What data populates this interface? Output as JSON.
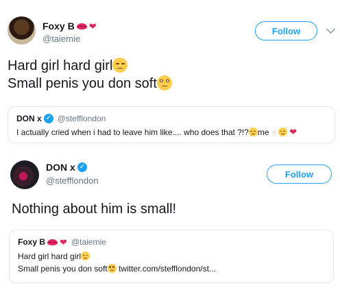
{
  "tweet1": {
    "name": "Foxy B",
    "handle": "@taiemie",
    "follow_label": "Follow",
    "line1": "Hard girl hard girl",
    "line2": "Small penis you don soft",
    "quote": {
      "name": "DON x",
      "handle": "@stefflondon",
      "text": "I actually cried when i had to leave him like.... who does that ?!?",
      "suffix": "me"
    }
  },
  "tweet2": {
    "name": "DON x",
    "handle": "@stefflondon",
    "follow_label": "Follow",
    "text": "Nothing about him is small!",
    "quote": {
      "name": "Foxy B",
      "handle": "@taiemie",
      "line1": "Hard girl hard girl",
      "line2": "Small penis you don soft",
      "link": "twitter.com/stefflondon/st..."
    }
  },
  "colors": {
    "accent": "#1da1f2",
    "secondary_text": "#657786",
    "heart": "#e0245e"
  },
  "icons": [
    "lips-emoji",
    "heart-emoji",
    "verified-badge-icon",
    "chevron-down-icon",
    "unamused-face-emoji",
    "eye-roll-emoji",
    "grimace-emoji",
    "point-up-hand-emoji",
    "crying-face-emoji"
  ]
}
